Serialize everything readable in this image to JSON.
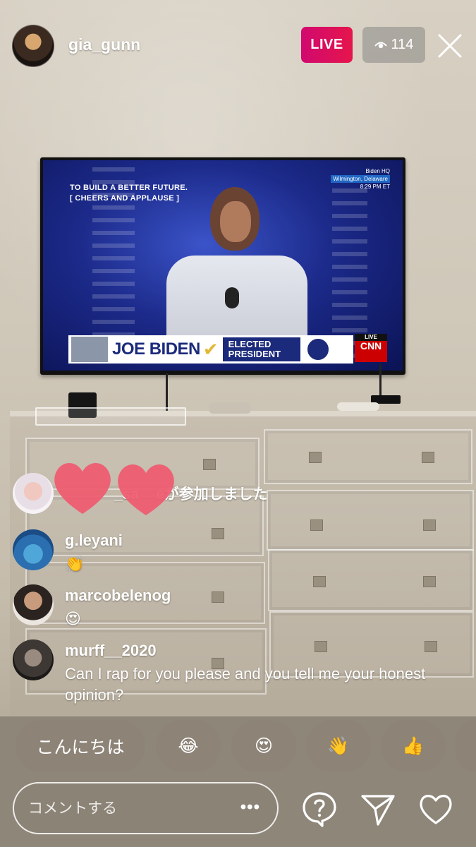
{
  "host": {
    "username": "gia_gunn",
    "avatar_icon": "host-avatar"
  },
  "live": {
    "badge_label": "LIVE",
    "viewer_count": "114",
    "viewer_icon": "eye-icon",
    "close_icon": "close-icon"
  },
  "broadcast": {
    "caption_line1": "TO BUILD A BETTER FUTURE.",
    "caption_line2": "[ CHEERS AND APPLAUSE ]",
    "location_title": "Biden HQ",
    "location_place": "Wilmington, Delaware",
    "location_time": "8:29 PM ET",
    "lower_third_name": "JOE BIDEN",
    "lower_third_tag": "ELECTED PRESIDENT",
    "network_live": "LIVE",
    "network": "CNN"
  },
  "comments": [
    {
      "type": "join",
      "username_fragment": "_sa",
      "text": "eが参加しました"
    },
    {
      "type": "comment",
      "username": "g.leyani",
      "text": "👏"
    },
    {
      "type": "comment",
      "username": "marcobelenog",
      "text": "😍"
    },
    {
      "type": "comment",
      "username": "murff__2020",
      "text": "Can I rap for you please and you tell me your honest opinion?"
    }
  ],
  "quick_reactions": [
    "こんにちは",
    "😂",
    "😍",
    "👋",
    "👍"
  ],
  "composer": {
    "placeholder": "コメントする",
    "more_label": "•••"
  },
  "actions": {
    "question_icon": "question-bubble-icon",
    "share_icon": "send-icon",
    "like_icon": "heart-outline-icon"
  },
  "colors": {
    "live_badge": "#e1156a",
    "floating_heart": "#ef5a6f"
  }
}
